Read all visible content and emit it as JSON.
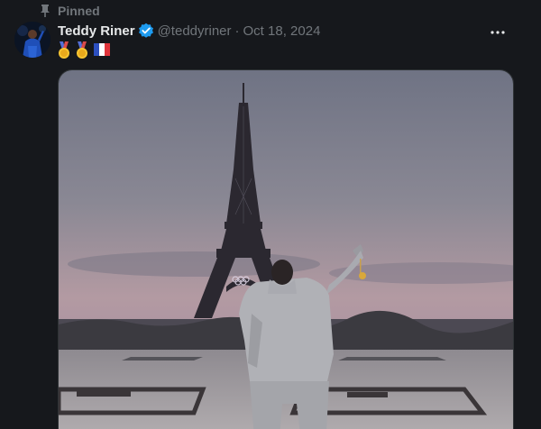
{
  "pinned": {
    "label": "Pinned",
    "icon": "pin-icon"
  },
  "author": {
    "name": "Teddy Riner",
    "handle": "@teddyriner",
    "verified": true,
    "avatar_icon": "avatar-image"
  },
  "post": {
    "separator": "·",
    "date": "Oct 18, 2024",
    "text_emojis": [
      "gold-medal-emoji",
      "gold-medal-emoji",
      "france-flag-emoji"
    ]
  },
  "more_icon": "more-icon",
  "media": {
    "icon": "eiffel-tower-photo"
  },
  "colors": {
    "background": "#16181c",
    "text_primary": "#e7e9ea",
    "text_secondary": "#71767b",
    "verified_blue": "#1d9bf0"
  }
}
